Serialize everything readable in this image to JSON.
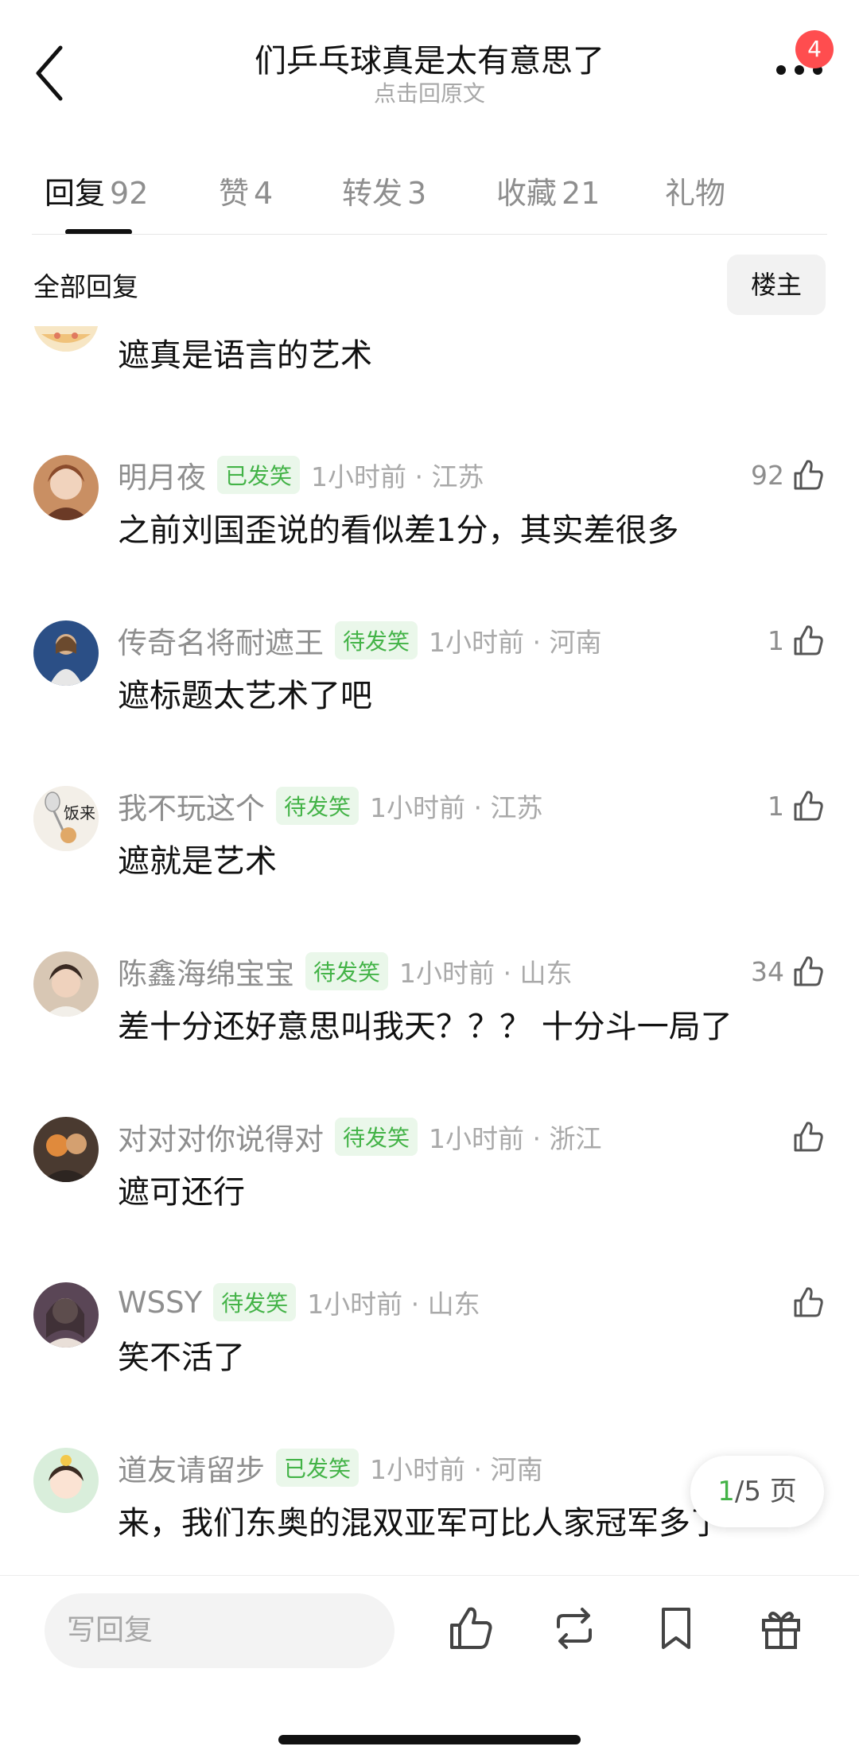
{
  "header": {
    "title": "们乒乓球真是太有意思了",
    "subtitle": "点击回原文",
    "badge": "4"
  },
  "tabs": [
    {
      "label": "回复",
      "count": "92"
    },
    {
      "label": "赞",
      "count": "4"
    },
    {
      "label": "转发",
      "count": "3"
    },
    {
      "label": "收藏",
      "count": "21"
    },
    {
      "label": "礼物",
      "count": ""
    }
  ],
  "section": {
    "title": "全部回复",
    "owner_button": "楼主"
  },
  "comments": [
    {
      "name": "",
      "tag": "",
      "time": "",
      "likes": "",
      "text": "遮真是语言的艺术"
    },
    {
      "name": "明月夜",
      "tag": "已发笑",
      "time": "1小时前 · 江苏",
      "likes": "92",
      "text": "之前刘国歪说的看似差1分，其实差很多"
    },
    {
      "name": "传奇名将耐遮王",
      "tag": "待发笑",
      "time": "1小时前 · 河南",
      "likes": "1",
      "text": "遮标题太艺术了吧"
    },
    {
      "name": "我不玩这个",
      "tag": "待发笑",
      "time": "1小时前 · 江苏",
      "likes": "1",
      "text": "遮就是艺术",
      "avatar_text": "饭来"
    },
    {
      "name": "陈鑫海绵宝宝",
      "tag": "待发笑",
      "time": "1小时前 · 山东",
      "likes": "34",
      "text": "差十分还好意思叫我天？？？ 十分斗一局了"
    },
    {
      "name": "对对对你说得对",
      "tag": "待发笑",
      "time": "1小时前 · 浙江",
      "likes": "",
      "text": "遮可还行"
    },
    {
      "name": "WSSY",
      "tag": "待发笑",
      "time": "1小时前 · 山东",
      "likes": "",
      "text": "笑不活了"
    },
    {
      "name": "道友请留步",
      "tag": "已发笑",
      "time": "1小时前 · 河南",
      "likes": "",
      "text": "来，我们东奥的混双亚军可比人家冠军多了"
    }
  ],
  "pager": {
    "current": "1",
    "total": "/5 页"
  },
  "bottom": {
    "reply_placeholder": "写回复"
  },
  "colors": {
    "accent_green": "#43b347",
    "badge_red": "#ff4d4f"
  },
  "icons": [
    "back-icon",
    "more-icon",
    "like-icon",
    "repost-icon",
    "bookmark-icon",
    "gift-icon"
  ]
}
